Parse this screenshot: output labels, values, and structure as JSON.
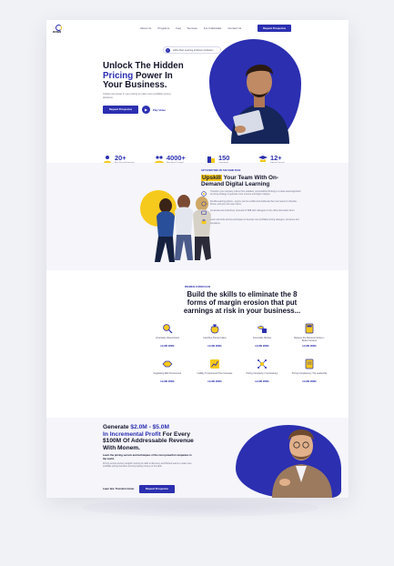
{
  "header": {
    "logo_text": "MONEM",
    "nav": [
      "About Us",
      "Programs",
      "Faq",
      "Success",
      "For Individuals",
      "Contact Us"
    ],
    "cta": "Request Prospectus"
  },
  "hero": {
    "badge": "1000+ Best Learning at Monem Institution",
    "title_line1": "Unlock The Hidden",
    "title_highlight": "Pricing",
    "title_line2": " Power In",
    "title_line3": "Your Business.",
    "subtitle": "Unlock new power in your pricing to make more profitable pricing decisions.",
    "primary_button": "Request Prospectus",
    "play_label": "Play Video"
  },
  "stats": [
    {
      "number": "20+",
      "label": "Best Pricing Exercises",
      "icon": "people-icon"
    },
    {
      "number": "4000+",
      "label": "Executives Trained",
      "icon": "group-icon"
    },
    {
      "number": "150",
      "label": "Companies",
      "icon": "building-icon"
    },
    {
      "number": "12+",
      "label": "Industry Served",
      "icon": "graduate-icon"
    }
  ],
  "upskill": {
    "kicker": "GET EVERYONE ON THE SAME PAGE",
    "title_mark": "Upskill",
    "title_rest": " Your Team With On-Demand Digital Learning",
    "features": [
      "Transform your company culture from outdated, commoditized thinking to a value-based approach to pricing strategy to generate more revenue and higher margins.",
      "Flexible learning options - anyone can be certified and deliberate their own learner's schedule - fitness, and your own team hours.",
      "Accelerate and embed key concepts for B2B with colleagues in the online discussion forum.",
      "Learn vital tools and key techniques to develop more profitable pricing strategies, structures and operations."
    ]
  },
  "skills": {
    "kicker": "PREMIUM CURRICULUM",
    "title": "Build the skills to eliminate the 8 forms of margin erosion that put earnings at risk in your business...",
    "link_label": "LEARN MORE",
    "tiles": [
      {
        "title": "Uncertainty Value Erosion",
        "icon": "magnifier-icon"
      },
      {
        "title": "Cost-Plus Pricing Culture",
        "icon": "money-bag-icon"
      },
      {
        "title": "Commodity Mindset",
        "icon": "coins-icon"
      },
      {
        "title": "Between the Discounts Sucker + Broker Services",
        "icon": "calculator-icon"
      },
      {
        "title": "Negotiating With Procurement",
        "icon": "handshake-icon"
      },
      {
        "title": "Inability To Implement Price Increases",
        "icon": "growth-chart-icon"
      },
      {
        "title": "Pricing Complexity / Inconsistency",
        "icon": "network-icon"
      },
      {
        "title": "Pricing Complacency / No Leadership",
        "icon": "document-icon"
      }
    ]
  },
  "cta": {
    "title_line1": "Generate ",
    "title_highlight1": "$2.0M - $5.0M",
    "title_highlight2": "In Incremental Profit",
    "title_line2": " For Every $100M Of Addressable Revenue With Monem.",
    "subtitle": "Learn the pricing secrets and techniques of the most powerful companies in the world.",
    "body": "Pricing secrets and key insights! Getting the skills in discovery and finished teams to make more profitable pricing decisions and stop leaving money on the table.",
    "lead": "Learn fast. Transform faster.",
    "button": "Request Prospectus"
  },
  "colors": {
    "primary": "#2b2fb0",
    "accent": "#f6c91d",
    "text": "#14142b",
    "muted": "#6e6e88",
    "section_bg": "#f5f5fa"
  }
}
